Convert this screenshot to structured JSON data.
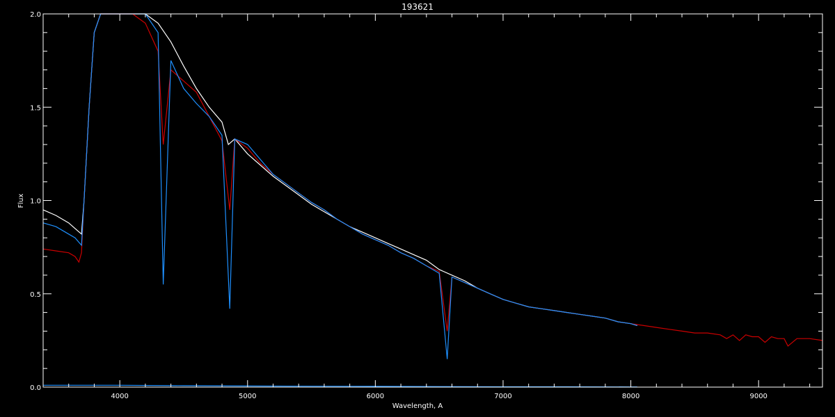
{
  "chart_data": {
    "type": "line",
    "title": "193621",
    "xlabel": "Wavelength, A",
    "ylabel": "Flux",
    "xlim": [
      3400,
      9500
    ],
    "ylim": [
      0,
      2.0
    ],
    "x_ticks": [
      4000,
      5000,
      6000,
      7000,
      8000,
      9000
    ],
    "y_ticks": [
      0.0,
      0.5,
      1.0,
      1.5,
      2.0
    ],
    "y_tick_labels": [
      "0.0",
      "0.5",
      "1.0",
      "1.5",
      "2.0"
    ],
    "grid": false,
    "background": "#000000",
    "series": [
      {
        "color": "#ffffff",
        "x": [
          3400,
          3500,
          3600,
          3650,
          3700,
          3720,
          3760,
          3800,
          3850,
          3900,
          4000,
          4100,
          4200,
          4300,
          4400,
          4500,
          4600,
          4700,
          4800,
          4850,
          4900,
          5000,
          5100,
          5200,
          5300,
          5400,
          5500,
          5600,
          5700,
          5800,
          5900,
          6000,
          6100,
          6200,
          6300,
          6400,
          6500,
          6600,
          6700,
          6800,
          6900,
          7000,
          7100,
          7200,
          7300,
          7400,
          7500,
          7600,
          7700,
          7800,
          7900,
          8000,
          8050
        ],
        "y": [
          0.95,
          0.92,
          0.88,
          0.85,
          0.82,
          1.0,
          1.5,
          1.9,
          2.0,
          2.0,
          2.0,
          2.0,
          2.0,
          1.95,
          1.85,
          1.72,
          1.6,
          1.5,
          1.42,
          1.3,
          1.33,
          1.25,
          1.19,
          1.13,
          1.08,
          1.03,
          0.98,
          0.94,
          0.9,
          0.86,
          0.83,
          0.8,
          0.77,
          0.74,
          0.71,
          0.68,
          0.63,
          0.6,
          0.57,
          0.53,
          0.5,
          0.47,
          0.45,
          0.43,
          0.42,
          0.41,
          0.4,
          0.39,
          0.38,
          0.37,
          0.35,
          0.34,
          0.33
        ]
      },
      {
        "color": "#cc0000",
        "x": [
          3400,
          3500,
          3600,
          3650,
          3680,
          3700,
          3720,
          3760,
          3800,
          3850,
          3900,
          4000,
          4100,
          4200,
          4300,
          4340,
          4400,
          4500,
          4600,
          4700,
          4800,
          4861,
          4900,
          5000,
          5100,
          5200,
          5300,
          5400,
          5500,
          5600,
          5700,
          5800,
          5900,
          6000,
          6100,
          6200,
          6300,
          6400,
          6500,
          6563,
          6600,
          6700,
          6800,
          6900,
          7000,
          7100,
          7200,
          7300,
          7400,
          7500,
          7600,
          7700,
          7800,
          7900,
          8000,
          8100,
          8200,
          8300,
          8400,
          8500,
          8600,
          8700,
          8750,
          8800,
          8850,
          8900,
          8950,
          9000,
          9050,
          9100,
          9150,
          9200,
          9230,
          9300,
          9400,
          9500
        ],
        "y": [
          0.74,
          0.73,
          0.72,
          0.7,
          0.67,
          0.72,
          1.0,
          1.5,
          1.9,
          2.0,
          2.0,
          2.0,
          2.0,
          1.95,
          1.8,
          1.3,
          1.7,
          1.64,
          1.58,
          1.45,
          1.32,
          0.95,
          1.33,
          1.28,
          1.2,
          1.14,
          1.09,
          1.04,
          0.99,
          0.95,
          0.9,
          0.86,
          0.82,
          0.79,
          0.76,
          0.72,
          0.69,
          0.65,
          0.62,
          0.3,
          0.59,
          0.56,
          0.53,
          0.5,
          0.47,
          0.45,
          0.43,
          0.42,
          0.41,
          0.4,
          0.39,
          0.38,
          0.37,
          0.35,
          0.34,
          0.33,
          0.32,
          0.31,
          0.3,
          0.29,
          0.29,
          0.28,
          0.26,
          0.28,
          0.25,
          0.28,
          0.27,
          0.27,
          0.24,
          0.27,
          0.26,
          0.26,
          0.22,
          0.26,
          0.26,
          0.25
        ]
      },
      {
        "color": "#1e90ff",
        "x": [
          3400,
          3500,
          3600,
          3650,
          3700,
          3720,
          3760,
          3800,
          3850,
          3900,
          4000,
          4100,
          4200,
          4300,
          4340,
          4400,
          4500,
          4600,
          4700,
          4800,
          4861,
          4900,
          5000,
          5100,
          5200,
          5300,
          5400,
          5500,
          5600,
          5700,
          5800,
          5900,
          6000,
          6100,
          6200,
          6300,
          6400,
          6500,
          6563,
          6600,
          6700,
          6800,
          6900,
          7000,
          7100,
          7200,
          7300,
          7400,
          7500,
          7600,
          7700,
          7800,
          7900,
          8000,
          8050
        ],
        "y": [
          0.88,
          0.86,
          0.82,
          0.8,
          0.76,
          1.0,
          1.5,
          1.9,
          2.0,
          2.0,
          2.0,
          2.0,
          2.0,
          1.9,
          0.55,
          1.75,
          1.6,
          1.52,
          1.45,
          1.35,
          0.42,
          1.33,
          1.3,
          1.22,
          1.14,
          1.09,
          1.04,
          0.99,
          0.95,
          0.9,
          0.86,
          0.82,
          0.79,
          0.76,
          0.72,
          0.69,
          0.65,
          0.61,
          0.15,
          0.59,
          0.56,
          0.53,
          0.5,
          0.47,
          0.45,
          0.43,
          0.42,
          0.41,
          0.4,
          0.39,
          0.38,
          0.37,
          0.35,
          0.34,
          0.33
        ]
      },
      {
        "color": "#1e90ff",
        "x": [
          3400,
          4000,
          4500,
          5000,
          5500,
          6000,
          6500,
          7000,
          7500,
          8000,
          8050
        ],
        "y": [
          0.01,
          0.01,
          0.008,
          0.006,
          0.005,
          0.004,
          0.003,
          0.002,
          0.002,
          0.001,
          0.001
        ]
      }
    ]
  }
}
